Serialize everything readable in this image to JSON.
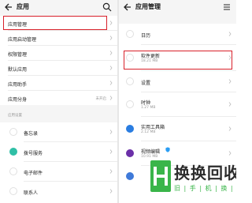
{
  "left": {
    "title": "应用",
    "items": [
      {
        "label": "应用管理"
      },
      {
        "label": "应用启动管理"
      },
      {
        "label": "权限管理"
      },
      {
        "label": "默认应用"
      },
      {
        "label": "应用助手"
      },
      {
        "label": "应用分身",
        "value": "未开启"
      }
    ],
    "section_label": "应用设置",
    "apps": [
      {
        "label": "备忘录"
      },
      {
        "label": "拨号服务"
      },
      {
        "label": "电子邮件"
      },
      {
        "label": "联系人"
      }
    ]
  },
  "right": {
    "title": "应用管理",
    "items": [
      {
        "label": "日历",
        "size": ""
      },
      {
        "label": "软件更新",
        "size": "18.21 MB"
      },
      {
        "label": "设置",
        "size": ""
      },
      {
        "label": "时钟",
        "size": "1.27 MB"
      },
      {
        "label": "实用工具箱",
        "size": "2.12 MB"
      },
      {
        "label": "视频编辑",
        "size": "10.91 MB"
      }
    ]
  },
  "watermark": {
    "big": "换换回收",
    "small": "旧 | 手 | 机 | 换 | 钱"
  },
  "colors": {
    "highlight": "#d8202a",
    "accent": "#3ab54a"
  }
}
